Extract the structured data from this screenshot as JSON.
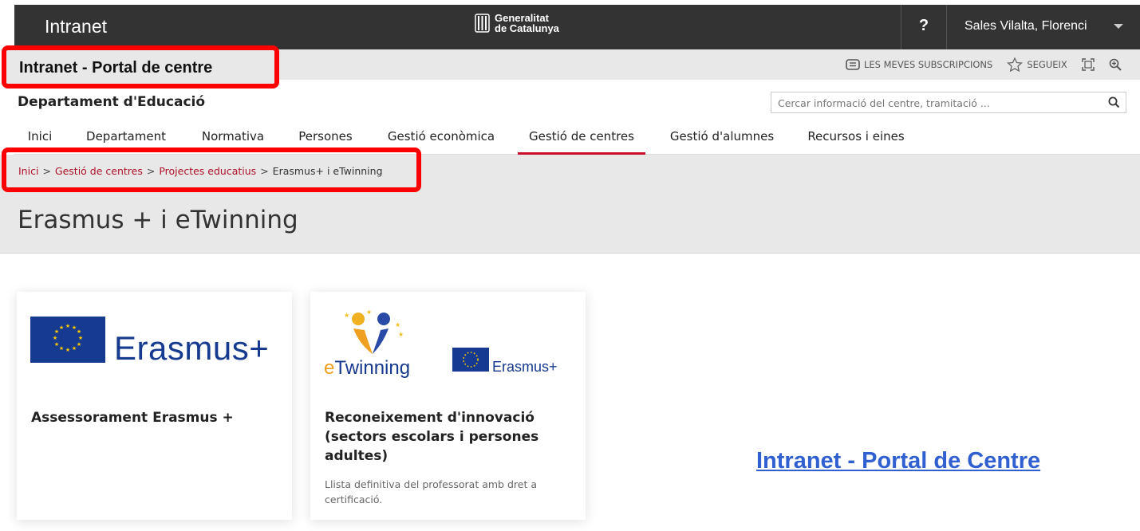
{
  "topbar": {
    "app_title": "Intranet",
    "gencat_line1": "Generalitat",
    "gencat_line2": "de Catalunya",
    "help": "?",
    "user": "Sales Vilalta, Florenci"
  },
  "portal": {
    "title": "Intranet - Portal de centre",
    "subscriptions": "LES MEVES SUBSCRIPCIONS",
    "follow": "SEGUEIX"
  },
  "department": "Departament d'Educació",
  "search": {
    "placeholder": "Cercar informació del centre, tramitació ..."
  },
  "nav": {
    "items": [
      {
        "label": "Inici"
      },
      {
        "label": "Departament"
      },
      {
        "label": "Normativa"
      },
      {
        "label": "Persones"
      },
      {
        "label": "Gestió econòmica"
      },
      {
        "label": "Gestió de centres"
      },
      {
        "label": "Gestió d'alumnes"
      },
      {
        "label": "Recursos i eines"
      }
    ],
    "active": "Gestió de centres"
  },
  "breadcrumb": {
    "items": [
      "Inici",
      "Gestió de centres",
      "Projectes educatius",
      "Erasmus+ i eTwinning"
    ],
    "separator": ">"
  },
  "page_title": "Erasmus + i eTwinning",
  "cards": [
    {
      "logo_text": "Erasmus+",
      "title": "Assessorament Erasmus +"
    },
    {
      "logo_text_1": "Twinning",
      "logo_text_1_prefix": "e",
      "logo_text_2": "Erasmus+",
      "title": "Reconeixement d'innovació (sectors escolars i persones adultes)",
      "description": "Llista definitiva del professorat amb dret a certificació."
    }
  ],
  "bottom_link": "Intranet - Portal de Centre",
  "colors": {
    "topbar": "#333333",
    "accent_red": "#c8102e",
    "highlight_red": "#ff0000",
    "eu_blue": "#163a8f",
    "link_blue": "#2f5fd0"
  }
}
